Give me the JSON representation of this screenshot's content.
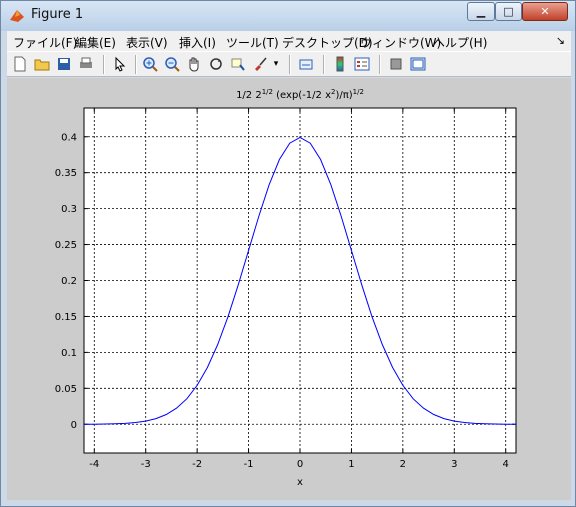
{
  "window": {
    "title": "Figure 1"
  },
  "menu": {
    "items": [
      "ファイル(F)",
      "編集(E)",
      "表示(V)",
      "挿入(I)",
      "ツール(T)",
      "デスクトップ(D)",
      "ウィンドウ(W)",
      "ヘルプ(H)"
    ],
    "more_glyph": "↘"
  },
  "toolbar": {
    "buttons": [
      {
        "name": "new-figure",
        "icon": "new-file-icon"
      },
      {
        "name": "open-file",
        "icon": "folder-open-icon"
      },
      {
        "name": "save",
        "icon": "save-icon"
      },
      {
        "name": "print",
        "icon": "print-icon"
      },
      {
        "name": "edit-plot",
        "icon": "pointer-icon"
      },
      {
        "name": "zoom-in",
        "icon": "zoom-in-icon"
      },
      {
        "name": "zoom-out",
        "icon": "zoom-out-icon"
      },
      {
        "name": "pan",
        "icon": "hand-icon"
      },
      {
        "name": "rotate-3d",
        "icon": "rotate-icon"
      },
      {
        "name": "data-cursor",
        "icon": "data-cursor-icon"
      },
      {
        "name": "brush",
        "icon": "brush-icon"
      },
      {
        "name": "link-plot",
        "icon": "link-icon"
      },
      {
        "name": "colorbar",
        "icon": "colorbar-icon"
      },
      {
        "name": "legend",
        "icon": "legend-icon"
      },
      {
        "name": "hide-plot-tools",
        "icon": "hide-tools-icon"
      },
      {
        "name": "show-plot-tools",
        "icon": "show-tools-icon"
      }
    ]
  },
  "chart_data": {
    "type": "line",
    "title_main": "1/2 2",
    "title_sup1": "1/2",
    "title_mid": " (exp(-1/2 x",
    "title_sup2": "2",
    "title_end": ")/π)",
    "title_sup3": "1/2",
    "xlabel": "x",
    "ylabel": "",
    "xlim": [
      -4.2,
      4.2
    ],
    "ylim": [
      -0.04,
      0.44
    ],
    "xticks": [
      -4,
      -3,
      -2,
      -1,
      0,
      1,
      2,
      3,
      4
    ],
    "yticks": [
      0,
      0.05,
      0.1,
      0.15,
      0.2,
      0.25,
      0.3,
      0.35,
      0.4
    ],
    "grid": true,
    "series": [
      {
        "color": "#0000ff",
        "x": [
          -4.2,
          -4.0,
          -3.8,
          -3.6,
          -3.4,
          -3.2,
          -3.0,
          -2.8,
          -2.6,
          -2.4,
          -2.2,
          -2.0,
          -1.8,
          -1.6,
          -1.4,
          -1.2,
          -1.0,
          -0.8,
          -0.6,
          -0.4,
          -0.2,
          0.0,
          0.2,
          0.4,
          0.6,
          0.8,
          1.0,
          1.2,
          1.4,
          1.6,
          1.8,
          2.0,
          2.2,
          2.4,
          2.6,
          2.8,
          3.0,
          3.2,
          3.4,
          3.6,
          3.8,
          4.0,
          4.2
        ],
        "y": [
          0.0001,
          0.0001,
          0.0003,
          0.0006,
          0.0012,
          0.0024,
          0.0044,
          0.0079,
          0.0136,
          0.0224,
          0.0355,
          0.054,
          0.079,
          0.1109,
          0.1497,
          0.1942,
          0.242,
          0.2897,
          0.3332,
          0.3683,
          0.391,
          0.3989,
          0.391,
          0.3683,
          0.3332,
          0.2897,
          0.242,
          0.1942,
          0.1497,
          0.1109,
          0.079,
          0.054,
          0.0355,
          0.0224,
          0.0136,
          0.0079,
          0.0044,
          0.0024,
          0.0012,
          0.0006,
          0.0003,
          0.0001,
          0.0001
        ]
      }
    ]
  }
}
